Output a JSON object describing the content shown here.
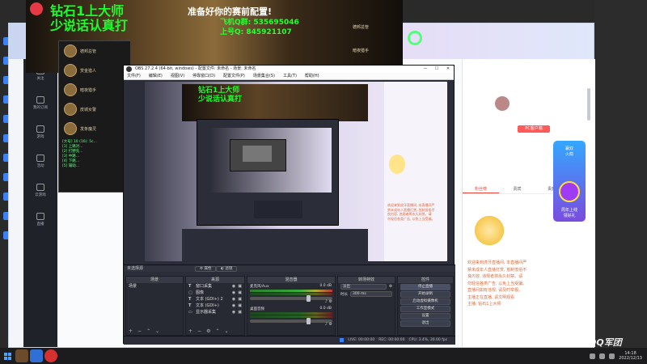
{
  "game": {
    "title": "准备好你的赛前配置!",
    "overlay_line1": "钻石1上大师",
    "overlay_line2": "少说话认真打",
    "qq1_label": "飞机Q群: 535695046",
    "qq2_label": "上号Q: 845921107",
    "right_card_1": "德邦总管",
    "right_card_2": "暗夜猎手"
  },
  "players": {
    "list": [
      "德邦总管",
      "赏金猎人",
      "暗夜猎手",
      "皮城女警",
      "发条魔灵"
    ],
    "log": [
      "[大号] 10 (16): 5c...",
      "[1] 上路对...",
      "[2] 打野先...",
      "[3] 中路...",
      "[4] 下路...",
      "[5] 辅助..."
    ]
  },
  "browser": {
    "sidebar": [
      "关注",
      "我的订阅",
      "游戏",
      "活动",
      "云游戏",
      "直播"
    ],
    "right_panel": {
      "pc_button": "PC客户端",
      "tabs": [
        "粉丝榜",
        "贵宾",
        "贵族榜"
      ],
      "active_tab": 0,
      "chat": [
        "欢迎来到虎牙直播间, 本直播间严",
        "禁未成年人直播打赏, 抵制低俗不",
        "良内容, 违规者将永久封禁。请",
        "勿轻信各类广告, 以免上当受骗。",
        "直播间如有违规, 请及时举报。",
        "主播正在直播, 请文明观看",
        "主播: 钻石1上大师"
      ],
      "ad_text": [
        "赢双",
        "火箭",
        "周年上线",
        "领好礼"
      ]
    }
  },
  "obs": {
    "title": "OBS 27.2.4 (64-bit, windows) - 配置文件: 未命名 - 场景: 未命名",
    "menu": [
      "文件(F)",
      "编辑(E)",
      "视图(V)",
      "停靠窗口(D)",
      "配置文件(P)",
      "场景集合(S)",
      "工具(T)",
      "帮助(H)"
    ],
    "preview_overlay1": "钻石1上大师",
    "preview_overlay2": "少说话认真打",
    "source_label": "未选择源",
    "props_btn": "属性",
    "filter_btn": "滤镜",
    "docks": {
      "scenes": "场景",
      "sources": "来源",
      "mixer": "混音器",
      "transitions": "转场特效",
      "controls": "控件"
    },
    "scenes": [
      "场景"
    ],
    "sources": [
      "窗口采集",
      "图像",
      "文本 (GDI+) 2",
      "文本 (GDI+)",
      "显示器采集"
    ],
    "mixer": [
      {
        "name": "麦克风/Aux",
        "db": "0.0 dB"
      },
      {
        "name": "桌面音频",
        "db": "0.0 dB"
      }
    ],
    "transition": {
      "type": "淡出",
      "duration_label": "时长",
      "duration": "300 ms"
    },
    "controls": [
      "停止直播",
      "开始录制",
      "启动虚拟摄像机",
      "工作室模式",
      "设置",
      "退出"
    ],
    "status": {
      "live": "LIVE: 00:00:00",
      "rec": "REC: 00:00:00",
      "cpu": "CPU: 3.4%, 30.00 fps"
    }
  },
  "taskbar": {
    "time": "14:18",
    "date": "2022/12/13"
  },
  "watermark": "QQ军团"
}
